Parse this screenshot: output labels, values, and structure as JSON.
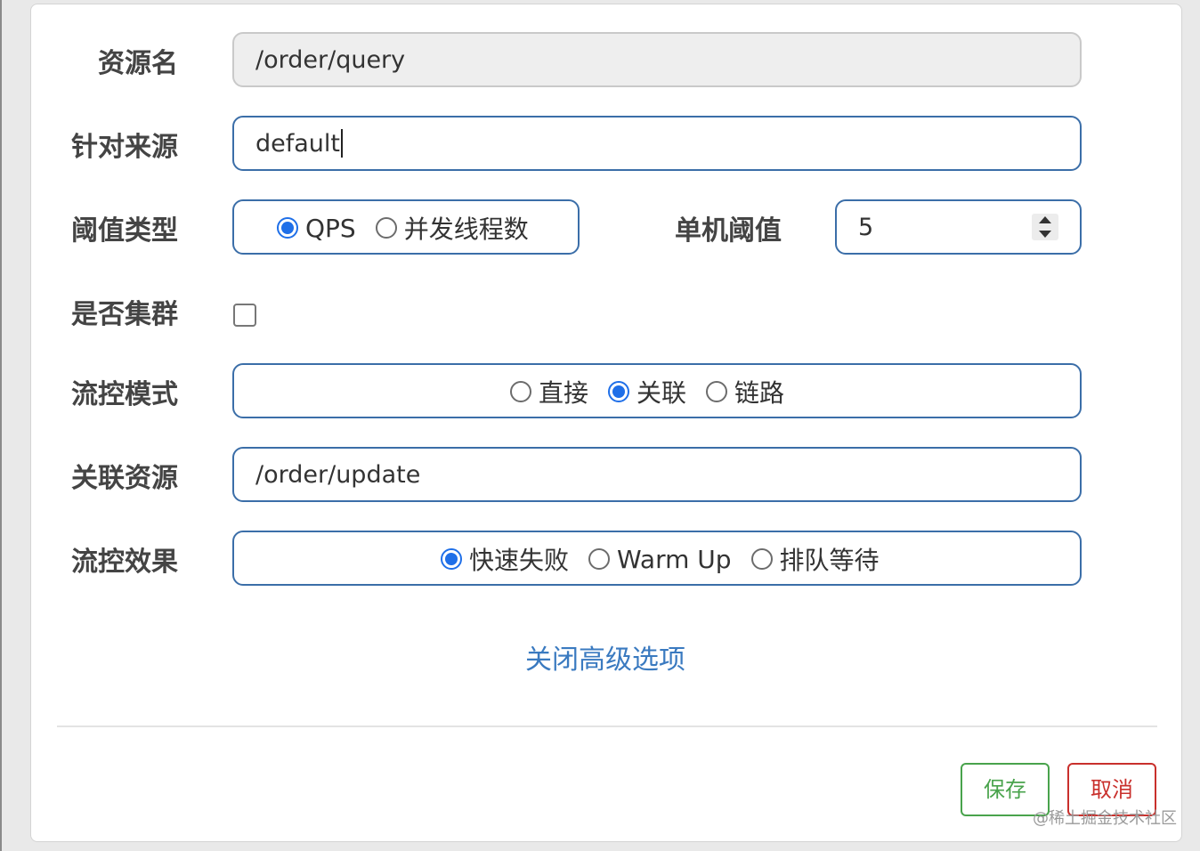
{
  "form": {
    "resource_name": {
      "label": "资源名",
      "value": "/order/query"
    },
    "limit_app": {
      "label": "针对来源",
      "value": "default"
    },
    "grade": {
      "label": "阈值类型",
      "options": [
        {
          "label": "QPS",
          "selected": true
        },
        {
          "label": "并发线程数",
          "selected": false
        }
      ]
    },
    "threshold": {
      "label": "单机阈值",
      "value": "5"
    },
    "cluster": {
      "label": "是否集群",
      "checked": false
    },
    "strategy": {
      "label": "流控模式",
      "options": [
        {
          "label": "直接",
          "selected": false
        },
        {
          "label": "关联",
          "selected": true
        },
        {
          "label": "链路",
          "selected": false
        }
      ]
    },
    "ref_resource": {
      "label": "关联资源",
      "value": "/order/update"
    },
    "control_behavior": {
      "label": "流控效果",
      "options": [
        {
          "label": "快速失败",
          "selected": true
        },
        {
          "label": "Warm Up",
          "selected": false
        },
        {
          "label": "排队等待",
          "selected": false
        }
      ]
    },
    "toggle_advanced": "关闭高级选项"
  },
  "footer": {
    "save_label": "保存",
    "cancel_label": "取消"
  },
  "watermark": "@稀土掘金技术社区",
  "colors": {
    "accent_blue": "#1f6fe8",
    "border_blue": "#3b6ea8",
    "link_blue": "#3a7ac0",
    "save_green": "#49a34c",
    "cancel_red": "#c9302c"
  }
}
